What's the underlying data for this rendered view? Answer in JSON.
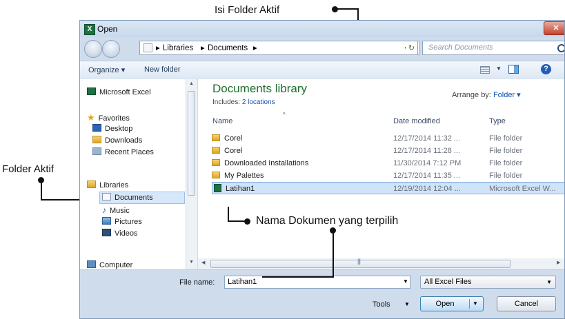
{
  "annotations": {
    "current_folder_contents": "Isi Folder Aktif",
    "active_folder": "Folder Aktif",
    "selected_document_name": "Nama Dokumen yang terpilih"
  },
  "window": {
    "title": "Open",
    "close_glyph": "✕"
  },
  "address_bar": {
    "segments": [
      "Libraries",
      "Documents"
    ],
    "separator": "▸",
    "search_placeholder": "Search Documents"
  },
  "toolbar": {
    "organize": "Organize ▾",
    "new_folder": "New folder",
    "help_glyph": "?"
  },
  "nav": {
    "items": [
      {
        "label": "Microsoft Excel",
        "icon": "excel-icon"
      },
      {
        "label": "Favorites",
        "icon": "star-icon"
      },
      {
        "label": "Desktop",
        "icon": "desktop-icon"
      },
      {
        "label": "Downloads",
        "icon": "downloads-icon"
      },
      {
        "label": "Recent Places",
        "icon": "recent-places-icon"
      },
      {
        "label": "Libraries",
        "icon": "libraries-icon"
      },
      {
        "label": "Documents",
        "icon": "documents-icon"
      },
      {
        "label": "Music",
        "icon": "music-icon"
      },
      {
        "label": "Pictures",
        "icon": "pictures-icon"
      },
      {
        "label": "Videos",
        "icon": "videos-icon"
      },
      {
        "label": "Computer",
        "icon": "computer-icon"
      }
    ],
    "selected": "Documents"
  },
  "library": {
    "title": "Documents library",
    "includes_label": "Includes:",
    "includes_link": "2 locations",
    "arrange_label": "Arrange by:",
    "arrange_value": "Folder ▾"
  },
  "columns": {
    "name": "Name",
    "date_modified": "Date modified",
    "type": "Type"
  },
  "files": [
    {
      "name": "Corel",
      "date": "12/17/2014 11:32 ...",
      "type": "File folder",
      "kind": "folder"
    },
    {
      "name": "Corel",
      "date": "12/17/2014 11:28 ...",
      "type": "File folder",
      "kind": "folder"
    },
    {
      "name": "Downloaded Installations",
      "date": "11/30/2014 7:12 PM",
      "type": "File folder",
      "kind": "folder"
    },
    {
      "name": "My Palettes",
      "date": "12/17/2014 11:35 ...",
      "type": "File folder",
      "kind": "folder"
    },
    {
      "name": "Latihan1",
      "date": "12/19/2014 12:04 ...",
      "type": "Microsoft Excel W...",
      "kind": "excel",
      "selected": true
    }
  ],
  "footer": {
    "file_name_label": "File name:",
    "file_name_value": "Latihan1",
    "file_type_value": "All Excel Files",
    "tools_label": "Tools",
    "open_label": "Open",
    "cancel_label": "Cancel"
  },
  "colors": {
    "library_title": "#1e6e2c",
    "link": "#0b53b0",
    "selection": "#cfe3f9"
  }
}
